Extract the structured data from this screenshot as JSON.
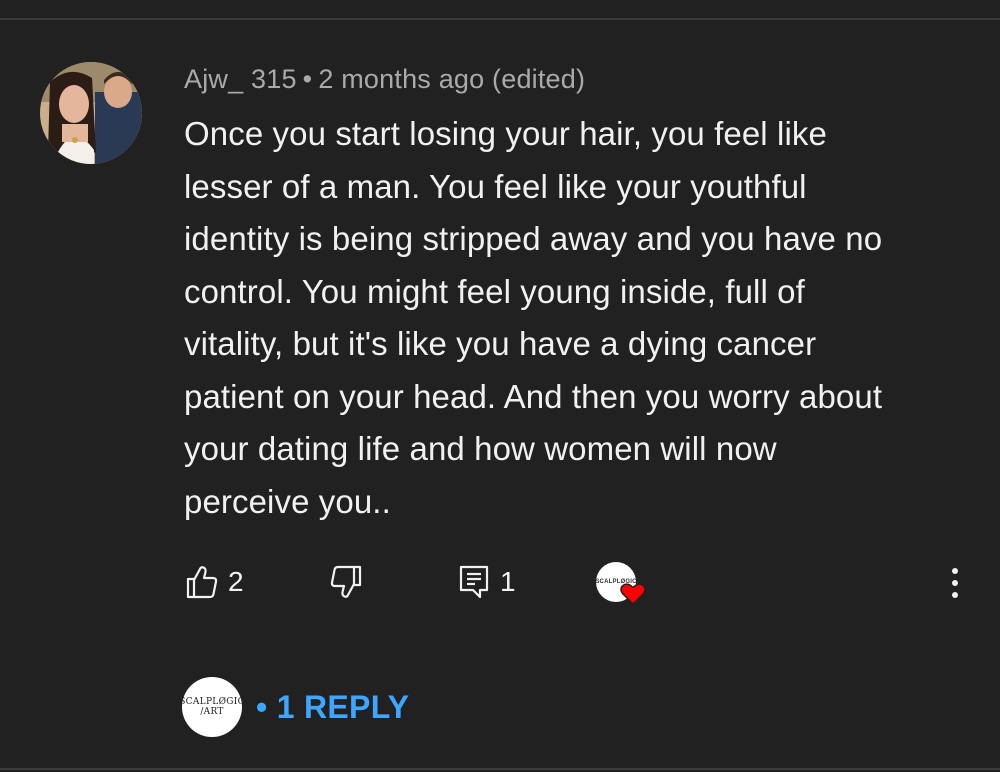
{
  "comment": {
    "author": "Ajw_ 315",
    "separator": "•",
    "time": "2 months ago (edited)",
    "text": "Once you start losing your hair, you feel like\nlesser of a man. You feel like your youthful\nidentity is being stripped away and you have no\ncontrol. You might feel young inside, full of\nvitality, but it's like you have a dying cancer\npatient on your head. And then you worry about\nyour dating life and how women will now\nperceive you.."
  },
  "actions": {
    "like_count": "2",
    "reply_count": "1",
    "like_icon": "thumbs-up-icon",
    "dislike_icon": "thumbs-down-icon",
    "reply_icon": "comment-reply-icon",
    "more_icon": "more-vert-icon",
    "hearted_icon": "creator-heart-icon"
  },
  "creator": {
    "logo_line1": "SCALPLØGIC",
    "logo_line2": "/ART"
  },
  "replies": {
    "bullet": "•",
    "label": "1 REPLY"
  },
  "colors": {
    "background": "#212121",
    "text": "#f1f1f1",
    "meta": "#aaaaaa",
    "reply_link": "#3ea6ff",
    "heart": "#ff0000"
  }
}
